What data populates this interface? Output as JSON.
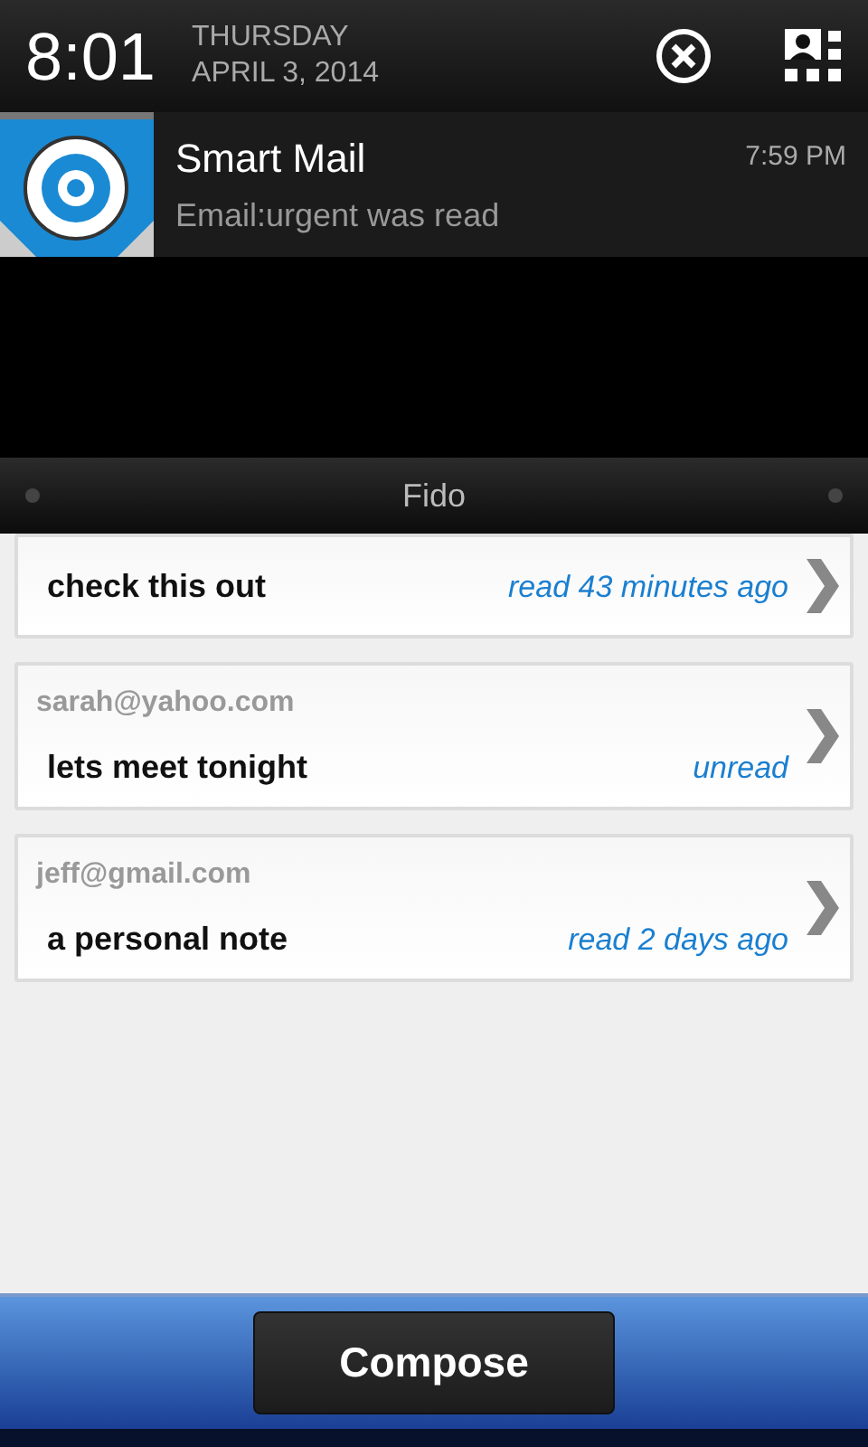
{
  "status_header": {
    "time": "8:01",
    "day": "THURSDAY",
    "date": "APRIL 3, 2014"
  },
  "notification": {
    "app": "Smart Mail",
    "message": "Email:urgent was read",
    "time": "7:59 PM"
  },
  "app_bar": {
    "title": "Fido"
  },
  "messages": [
    {
      "subject": "check this out",
      "status": "read 43 minutes ago"
    },
    {
      "sender": "sarah@yahoo.com",
      "subject": "lets meet tonight",
      "status": "unread"
    },
    {
      "sender": "jeff@gmail.com",
      "subject": "a personal note",
      "status": "read 2 days ago"
    }
  ],
  "compose_button": "Compose"
}
